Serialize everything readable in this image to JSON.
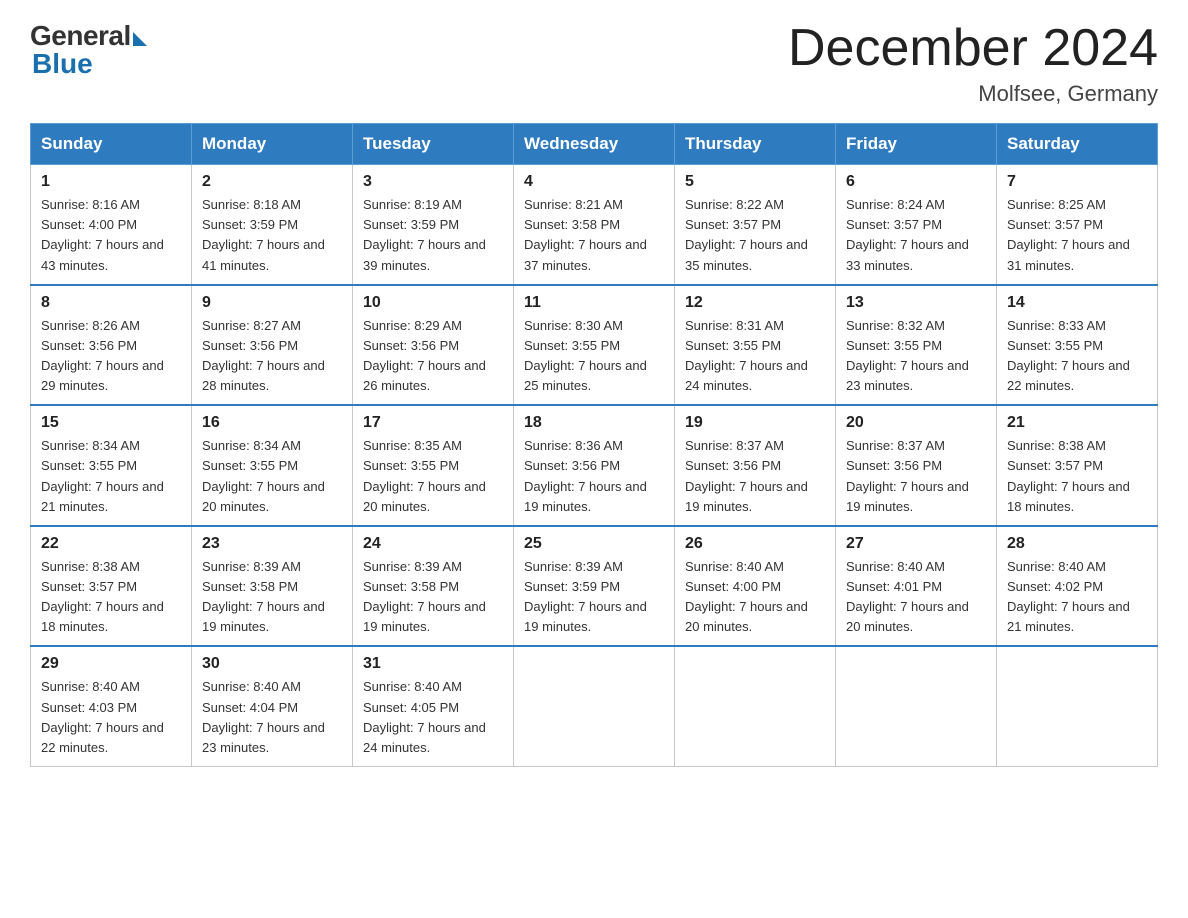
{
  "logo": {
    "general": "General",
    "blue": "Blue",
    "tagline": "Blue"
  },
  "title": "December 2024",
  "subtitle": "Molfsee, Germany",
  "days_of_week": [
    "Sunday",
    "Monday",
    "Tuesday",
    "Wednesday",
    "Thursday",
    "Friday",
    "Saturday"
  ],
  "weeks": [
    [
      {
        "day": "1",
        "sunrise": "8:16 AM",
        "sunset": "4:00 PM",
        "daylight": "7 hours and 43 minutes."
      },
      {
        "day": "2",
        "sunrise": "8:18 AM",
        "sunset": "3:59 PM",
        "daylight": "7 hours and 41 minutes."
      },
      {
        "day": "3",
        "sunrise": "8:19 AM",
        "sunset": "3:59 PM",
        "daylight": "7 hours and 39 minutes."
      },
      {
        "day": "4",
        "sunrise": "8:21 AM",
        "sunset": "3:58 PM",
        "daylight": "7 hours and 37 minutes."
      },
      {
        "day": "5",
        "sunrise": "8:22 AM",
        "sunset": "3:57 PM",
        "daylight": "7 hours and 35 minutes."
      },
      {
        "day": "6",
        "sunrise": "8:24 AM",
        "sunset": "3:57 PM",
        "daylight": "7 hours and 33 minutes."
      },
      {
        "day": "7",
        "sunrise": "8:25 AM",
        "sunset": "3:57 PM",
        "daylight": "7 hours and 31 minutes."
      }
    ],
    [
      {
        "day": "8",
        "sunrise": "8:26 AM",
        "sunset": "3:56 PM",
        "daylight": "7 hours and 29 minutes."
      },
      {
        "day": "9",
        "sunrise": "8:27 AM",
        "sunset": "3:56 PM",
        "daylight": "7 hours and 28 minutes."
      },
      {
        "day": "10",
        "sunrise": "8:29 AM",
        "sunset": "3:56 PM",
        "daylight": "7 hours and 26 minutes."
      },
      {
        "day": "11",
        "sunrise": "8:30 AM",
        "sunset": "3:55 PM",
        "daylight": "7 hours and 25 minutes."
      },
      {
        "day": "12",
        "sunrise": "8:31 AM",
        "sunset": "3:55 PM",
        "daylight": "7 hours and 24 minutes."
      },
      {
        "day": "13",
        "sunrise": "8:32 AM",
        "sunset": "3:55 PM",
        "daylight": "7 hours and 23 minutes."
      },
      {
        "day": "14",
        "sunrise": "8:33 AM",
        "sunset": "3:55 PM",
        "daylight": "7 hours and 22 minutes."
      }
    ],
    [
      {
        "day": "15",
        "sunrise": "8:34 AM",
        "sunset": "3:55 PM",
        "daylight": "7 hours and 21 minutes."
      },
      {
        "day": "16",
        "sunrise": "8:34 AM",
        "sunset": "3:55 PM",
        "daylight": "7 hours and 20 minutes."
      },
      {
        "day": "17",
        "sunrise": "8:35 AM",
        "sunset": "3:55 PM",
        "daylight": "7 hours and 20 minutes."
      },
      {
        "day": "18",
        "sunrise": "8:36 AM",
        "sunset": "3:56 PM",
        "daylight": "7 hours and 19 minutes."
      },
      {
        "day": "19",
        "sunrise": "8:37 AM",
        "sunset": "3:56 PM",
        "daylight": "7 hours and 19 minutes."
      },
      {
        "day": "20",
        "sunrise": "8:37 AM",
        "sunset": "3:56 PM",
        "daylight": "7 hours and 19 minutes."
      },
      {
        "day": "21",
        "sunrise": "8:38 AM",
        "sunset": "3:57 PM",
        "daylight": "7 hours and 18 minutes."
      }
    ],
    [
      {
        "day": "22",
        "sunrise": "8:38 AM",
        "sunset": "3:57 PM",
        "daylight": "7 hours and 18 minutes."
      },
      {
        "day": "23",
        "sunrise": "8:39 AM",
        "sunset": "3:58 PM",
        "daylight": "7 hours and 19 minutes."
      },
      {
        "day": "24",
        "sunrise": "8:39 AM",
        "sunset": "3:58 PM",
        "daylight": "7 hours and 19 minutes."
      },
      {
        "day": "25",
        "sunrise": "8:39 AM",
        "sunset": "3:59 PM",
        "daylight": "7 hours and 19 minutes."
      },
      {
        "day": "26",
        "sunrise": "8:40 AM",
        "sunset": "4:00 PM",
        "daylight": "7 hours and 20 minutes."
      },
      {
        "day": "27",
        "sunrise": "8:40 AM",
        "sunset": "4:01 PM",
        "daylight": "7 hours and 20 minutes."
      },
      {
        "day": "28",
        "sunrise": "8:40 AM",
        "sunset": "4:02 PM",
        "daylight": "7 hours and 21 minutes."
      }
    ],
    [
      {
        "day": "29",
        "sunrise": "8:40 AM",
        "sunset": "4:03 PM",
        "daylight": "7 hours and 22 minutes."
      },
      {
        "day": "30",
        "sunrise": "8:40 AM",
        "sunset": "4:04 PM",
        "daylight": "7 hours and 23 minutes."
      },
      {
        "day": "31",
        "sunrise": "8:40 AM",
        "sunset": "4:05 PM",
        "daylight": "7 hours and 24 minutes."
      },
      null,
      null,
      null,
      null
    ]
  ]
}
